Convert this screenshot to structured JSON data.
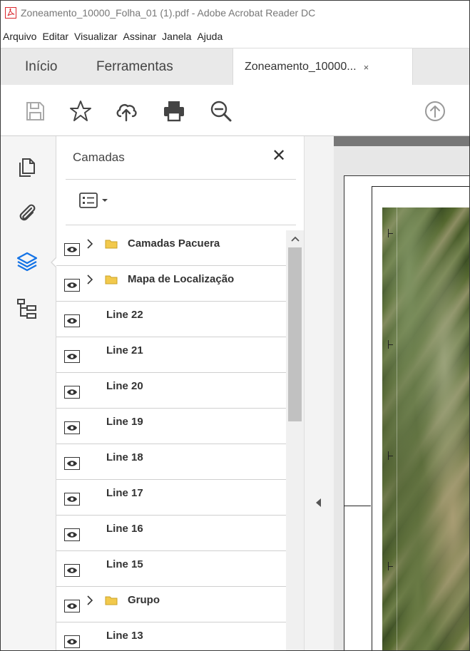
{
  "window": {
    "title": "Zoneamento_10000_Folha_01 (1).pdf - Adobe Acrobat Reader DC"
  },
  "menu": [
    "Arquivo",
    "Editar",
    "Visualizar",
    "Assinar",
    "Janela",
    "Ajuda"
  ],
  "tabs": {
    "home": "Início",
    "tools": "Ferramentas",
    "document": "Zoneamento_10000...",
    "close_glyph": "×"
  },
  "toolbar": {
    "icons": [
      "save-icon",
      "bookmark-star-icon",
      "upload-cloud-icon",
      "print-icon",
      "zoom-out-icon",
      "scroll-up-circle-icon"
    ]
  },
  "nav": {
    "icons": [
      "page-thumbnails-icon",
      "attachments-icon",
      "layers-icon",
      "content-tree-icon"
    ],
    "active": "layers-icon"
  },
  "layers_panel": {
    "title": "Camadas",
    "close_glyph": "✕",
    "layers": [
      {
        "label": "Camadas Pacuera",
        "group": true
      },
      {
        "label": "Mapa de Localização",
        "group": true
      },
      {
        "label": "Line 22",
        "group": false
      },
      {
        "label": "Line 21",
        "group": false
      },
      {
        "label": "Line 20",
        "group": false
      },
      {
        "label": "Line 19",
        "group": false
      },
      {
        "label": "Line 18",
        "group": false
      },
      {
        "label": "Line 17",
        "group": false
      },
      {
        "label": "Line 16",
        "group": false
      },
      {
        "label": "Line 15",
        "group": false
      },
      {
        "label": "Grupo",
        "group": true
      },
      {
        "label": "Line 13",
        "group": false
      }
    ]
  },
  "colors": {
    "pdf_red": "#d9262c",
    "layers_accent": "#1473e6",
    "folder_yellow": "#f2c94c"
  }
}
